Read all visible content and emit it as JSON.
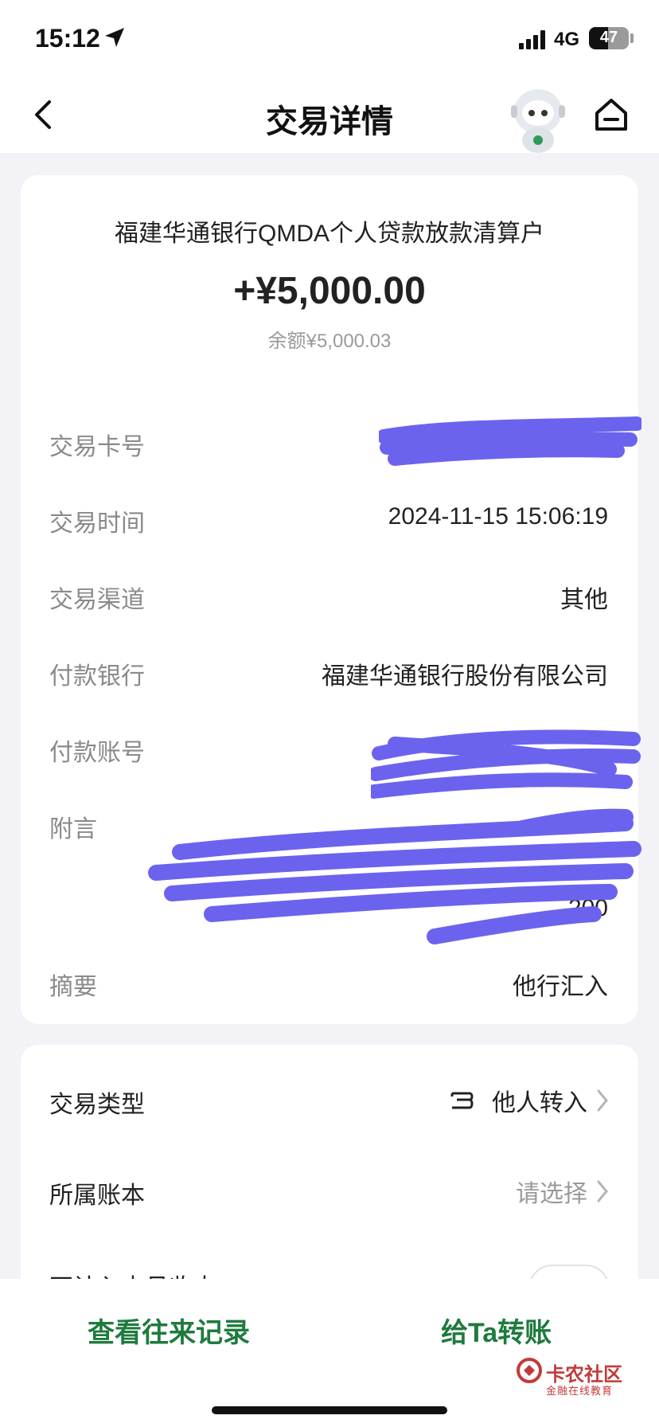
{
  "status_bar": {
    "time": "15:12",
    "network": "4G",
    "battery": "47",
    "battery_level_percent": 47
  },
  "nav": {
    "title": "交易详情"
  },
  "detail": {
    "payer_name": "福建华通银行QMDA个人贷款放款清算户",
    "amount": "+¥5,000.00",
    "balance_label": "余额",
    "balance_value": "¥5,000.03",
    "rows": [
      {
        "label": "交易卡号",
        "value": ""
      },
      {
        "label": "交易时间",
        "value": "2024-11-15 15:06:19"
      },
      {
        "label": "交易渠道",
        "value": "其他"
      },
      {
        "label": "付款银行",
        "value": "福建华通银行股份有限公司"
      },
      {
        "label": "付款账号",
        "value": ""
      },
      {
        "label": "附言",
        "value": "200"
      },
      {
        "label": "摘要",
        "value": "他行汇入"
      }
    ]
  },
  "classification": {
    "type_label": "交易类型",
    "type_value": "他人转入",
    "ledger_label": "所属账本",
    "ledger_value": "请选择",
    "exclude_label": "不计入本月收支"
  },
  "actions": {
    "history": "查看往来记录",
    "transfer": "给Ta转账"
  },
  "watermark": {
    "title": "卡农社区",
    "subtitle": "金融在线教育"
  },
  "colors": {
    "accent_green": "#1f7a3e",
    "redaction": "#6b63ee",
    "watermark_red": "#c43a3a"
  }
}
